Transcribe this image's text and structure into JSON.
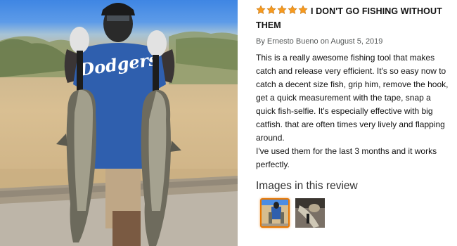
{
  "review": {
    "rating": 5,
    "rating_max": 5,
    "star_color": "#f79a1e",
    "title": "I DON'T GO FISHING WITHOUT THEM",
    "byline": "By Ernesto Bueno on August 5, 2019",
    "body_paragraphs": [
      "This is a really awesome fishing tool that makes catch and release very efficient. It's so easy now to catch a decent size fish, grip him, remove the hook, get a quick measurement with the tape, snap a quick fish-selfie. It's especially effective with big catfish. that are often times very lively and flapping around.",
      "I've used them for the last 3 months and it works perfectly."
    ]
  },
  "photo": {
    "shirt_text": "Dodgers",
    "shirt_color": "#2f5fae"
  },
  "images_section": {
    "heading": "Images in this review",
    "selected_index": 0,
    "thumb_count": 2,
    "selected_border_color": "#e77600"
  }
}
